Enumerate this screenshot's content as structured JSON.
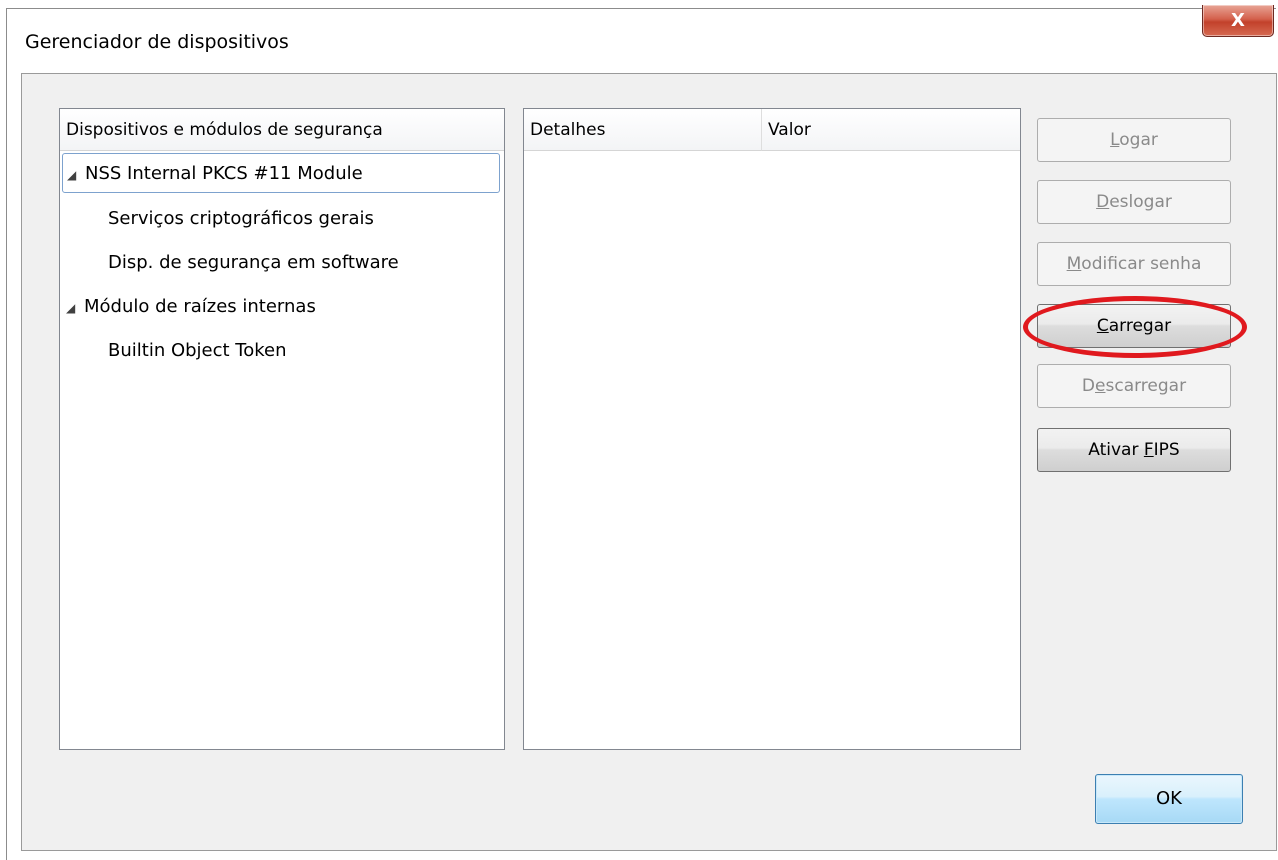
{
  "window": {
    "title": "Gerenciador de dispositivos",
    "close_glyph": "X"
  },
  "devices": {
    "header": "Dispositivos e módulos de segurança",
    "items": [
      {
        "label": "NSS Internal PKCS #11 Module",
        "expanded": true,
        "selected": true
      },
      {
        "label": "Serviços criptográficos gerais"
      },
      {
        "label": "Disp. de segurança em software"
      },
      {
        "label": "Módulo de raízes internas",
        "expanded": true
      },
      {
        "label": "Builtin Object Token"
      }
    ],
    "twisty_glyph": "◢"
  },
  "details": {
    "col_details": "Detalhes",
    "col_value": "Valor"
  },
  "buttons": {
    "logar": {
      "pre": "",
      "accel": "L",
      "post": "ogar",
      "enabled": false
    },
    "deslogar": {
      "pre": "",
      "accel": "D",
      "post": "eslogar",
      "enabled": false
    },
    "modificar": {
      "pre": "",
      "accel": "M",
      "post": "odificar senha",
      "enabled": false
    },
    "carregar": {
      "pre": "",
      "accel": "C",
      "post": "arregar",
      "enabled": true
    },
    "descarregar": {
      "pre": "D",
      "accel": "e",
      "post": "scarregar",
      "enabled": false
    },
    "fips": {
      "pre": "Ativar ",
      "accel": "F",
      "post": "IPS",
      "enabled": true
    }
  },
  "ok_label": "OK",
  "colors": {
    "highlight_ring": "#e0191e",
    "ok_border": "#3c7fb1",
    "selection_border": "#7da2ce"
  }
}
